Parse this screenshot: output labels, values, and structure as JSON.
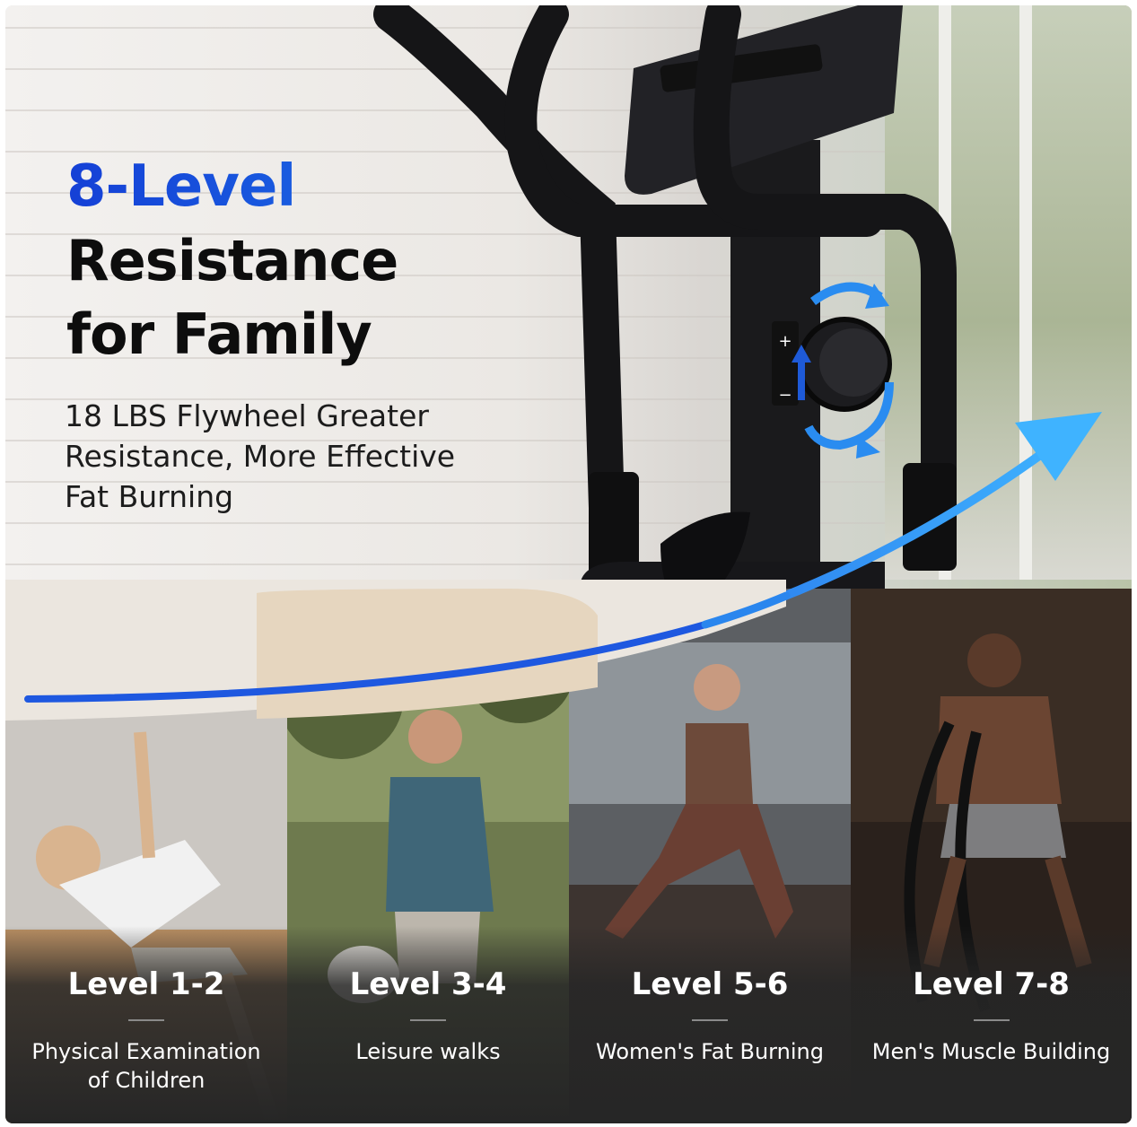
{
  "headline": {
    "accent": "8-Level",
    "line1": "Resistance",
    "line2": "for Family",
    "subtext": "18 LBS Flywheel Greater Resistance, More Effective Fat Burning"
  },
  "knob": {
    "plus": "+",
    "minus": "−"
  },
  "levels": [
    {
      "level": "Level 1-2",
      "description": "Physical Examination of Children"
    },
    {
      "level": "Level 3-4",
      "description": "Leisure walks"
    },
    {
      "level": "Level 5-6",
      "description": "Women's Fat Burning"
    },
    {
      "level": "Level 7-8",
      "description": "Men's Muscle Building"
    }
  ],
  "colors": {
    "accent_blue": "#1747d8",
    "arrow_blue": "#2a9bff",
    "panel_dark": "#262626"
  }
}
